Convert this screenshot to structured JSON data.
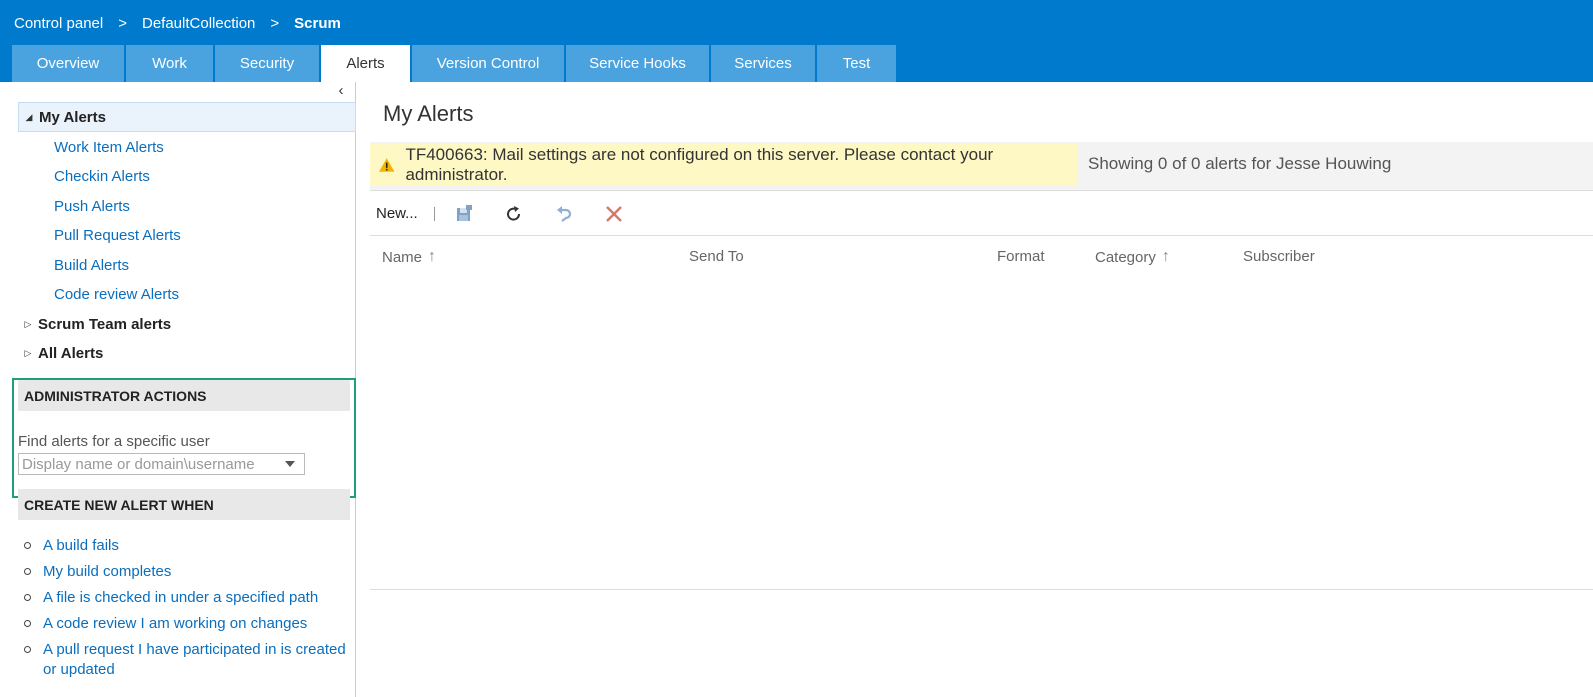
{
  "breadcrumb": {
    "items": [
      "Control panel",
      "DefaultCollection",
      "Scrum"
    ],
    "separator": ">"
  },
  "tabs": [
    "Overview",
    "Work",
    "Security",
    "Alerts",
    "Version Control",
    "Service Hooks",
    "Services",
    "Test"
  ],
  "active_tab": "Alerts",
  "tree": {
    "collapse_glyph": "‹",
    "my_alerts": {
      "label": "My Alerts",
      "children": [
        "Work Item Alerts",
        "Checkin Alerts",
        "Push Alerts",
        "Pull Request Alerts",
        "Build Alerts",
        "Code review Alerts"
      ]
    },
    "team_alerts": "Scrum Team alerts",
    "all_alerts": "All Alerts"
  },
  "admin": {
    "heading": "ADMINISTRATOR ACTIONS",
    "find_label": "Find alerts for a specific user",
    "placeholder": "Display name or domain\\username"
  },
  "create": {
    "heading": "CREATE NEW ALERT WHEN",
    "items": [
      "A build fails",
      "My build completes",
      "A file is checked in under a specified path",
      "A code review I am working on changes",
      "A pull request I have participated in is created or updated"
    ]
  },
  "main": {
    "title": "My Alerts",
    "warning": "TF400663: Mail settings are not configured on this server. Please contact your administrator.",
    "showing": "Showing 0 of 0 alerts for Jesse Houwing",
    "toolbar": {
      "new_label": "New...",
      "icons": [
        "save-icon",
        "refresh-icon",
        "undo-icon",
        "delete-icon"
      ]
    },
    "columns": {
      "name": "Name",
      "send_to": "Send To",
      "format": "Format",
      "category": "Category",
      "subscriber": "Subscriber",
      "sort_glyph": "↑"
    }
  },
  "colors": {
    "header": "#007acc",
    "tab": "#4aa3df",
    "link": "#0a6ebd",
    "warning_bg": "#fdf8c4",
    "admin_outline": "#1aa07a",
    "delete_icon": "#c0392b"
  }
}
